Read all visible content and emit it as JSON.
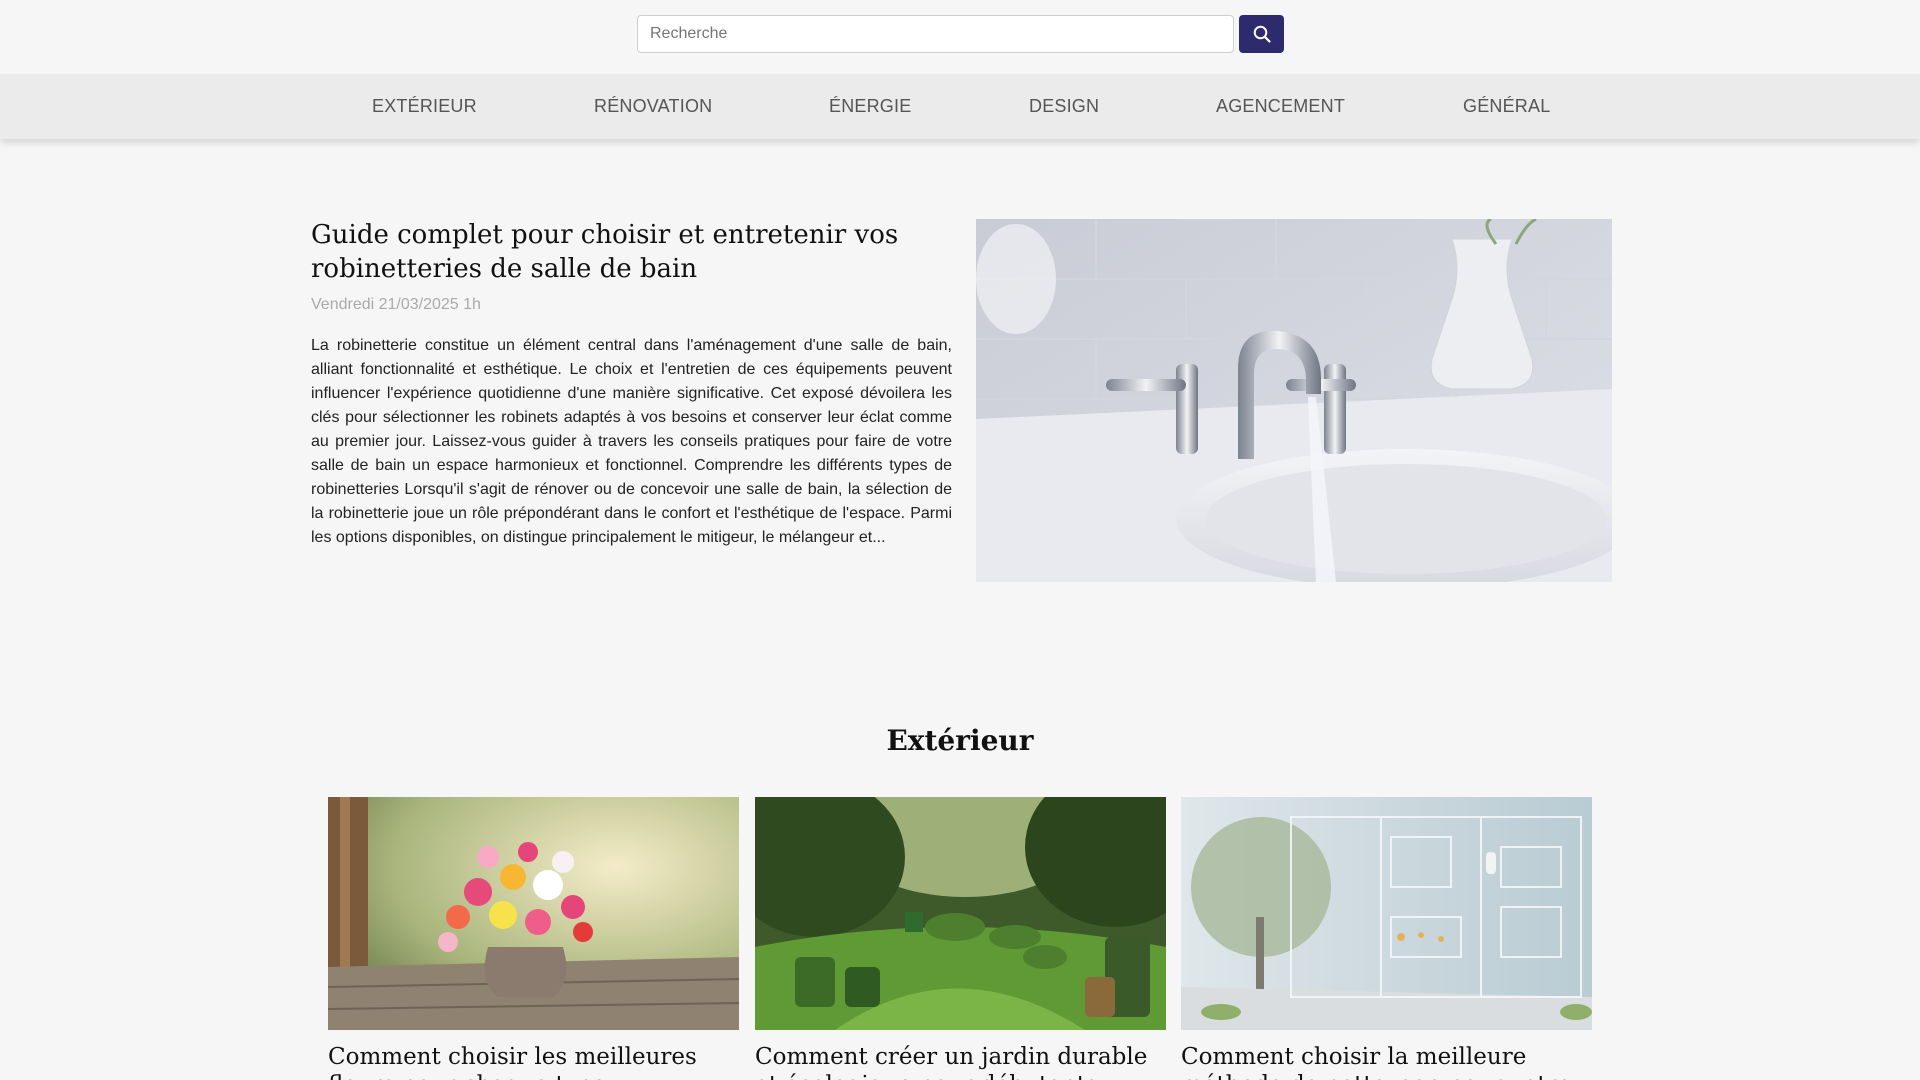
{
  "search": {
    "placeholder": "Recherche"
  },
  "nav": {
    "items": [
      {
        "label": "EXTÉRIEUR"
      },
      {
        "label": "RÉNOVATION"
      },
      {
        "label": "ÉNERGIE"
      },
      {
        "label": "DESIGN"
      },
      {
        "label": "AGENCEMENT"
      },
      {
        "label": "GÉNÉRAL"
      }
    ]
  },
  "featured": {
    "title": "Guide complet pour choisir et entretenir vos robinetteries de salle de bain",
    "date": "Vendredi 21/03/2025 1h",
    "excerpt": "La robinetterie constitue un élément central dans l'aménagement d'une salle de bain, alliant fonctionnalité et esthétique. Le choix et l'entretien de ces équipements peuvent influencer l'expérience quotidienne d'une manière significative. Cet exposé dévoilera les clés pour sélectionner les robinets adaptés à vos besoins et conserver leur éclat comme au premier jour. Laissez-vous guider à travers les conseils pratiques pour faire de votre salle de bain un espace harmonieux et fonctionnel. Comprendre les différents types de robinetteries Lorsqu'il s'agit de rénover ou de concevoir une salle de bain, la sélection de la robinetterie joue un rôle prépondérant dans le confort et l'esthétique de l'espace. Parmi les options disponibles, on distingue principalement le mitigeur, le mélangeur et..."
  },
  "section": {
    "title": "Extérieur",
    "cards": [
      {
        "title": "Comment choisir les meilleures fleurs pour chaque type"
      },
      {
        "title": "Comment créer un jardin durable et écologique pour débutants"
      },
      {
        "title": "Comment choisir la meilleure méthode de nettoyage pour votre"
      }
    ]
  },
  "colors": {
    "accent": "#2e2a6e",
    "nav_bg": "#ebebeb",
    "page_bg": "#f6f6f6"
  }
}
